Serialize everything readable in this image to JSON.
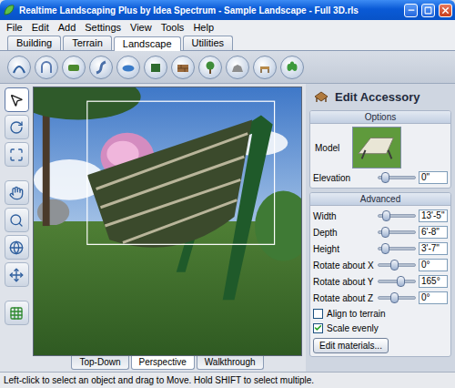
{
  "window": {
    "title": "Realtime Landscaping Plus by Idea Spectrum - Sample Landscape - Full 3D.rls"
  },
  "menu": [
    "File",
    "Edit",
    "Add",
    "Settings",
    "View",
    "Tools",
    "Help"
  ],
  "tabs": [
    {
      "label": "Building",
      "selected": false
    },
    {
      "label": "Terrain",
      "selected": false
    },
    {
      "label": "Landscape",
      "selected": true
    },
    {
      "label": "Utilities",
      "selected": false
    }
  ],
  "side_tools": [
    {
      "selected": true
    },
    {
      "selected": false
    },
    {
      "selected": false
    },
    {
      "selected": false
    },
    {
      "selected": false
    },
    {
      "selected": false
    },
    {
      "selected": false
    },
    {
      "selected": false
    }
  ],
  "view_tabs": [
    {
      "label": "Top-Down",
      "selected": false
    },
    {
      "label": "Perspective",
      "selected": true
    },
    {
      "label": "Walkthrough",
      "selected": false
    }
  ],
  "panel": {
    "title": "Edit Accessory",
    "options": {
      "title": "Options",
      "model_label": "Model",
      "rows": [
        {
          "label": "Elevation",
          "level": 0.2,
          "value": "0\""
        }
      ]
    },
    "advanced": {
      "title": "Advanced",
      "rows": [
        {
          "label": "Width",
          "level": 0.22,
          "value": "13'-5\""
        },
        {
          "label": "Depth",
          "level": 0.2,
          "value": "6'-8\""
        },
        {
          "label": "Height",
          "level": 0.2,
          "value": "3'-7\""
        },
        {
          "label": "Rotate about X",
          "level": 0.45,
          "value": "0°"
        },
        {
          "label": "Rotate about Y",
          "level": 0.62,
          "value": "165°"
        },
        {
          "label": "Rotate about Z",
          "level": 0.45,
          "value": "0°"
        }
      ],
      "checkboxes": [
        {
          "label": "Align to terrain",
          "checked": false
        },
        {
          "label": "Scale evenly",
          "checked": true
        }
      ],
      "button": "Edit materials..."
    }
  },
  "status_bar": "Left-click to select an object and drag to Move. Hold SHIFT to select multiple."
}
